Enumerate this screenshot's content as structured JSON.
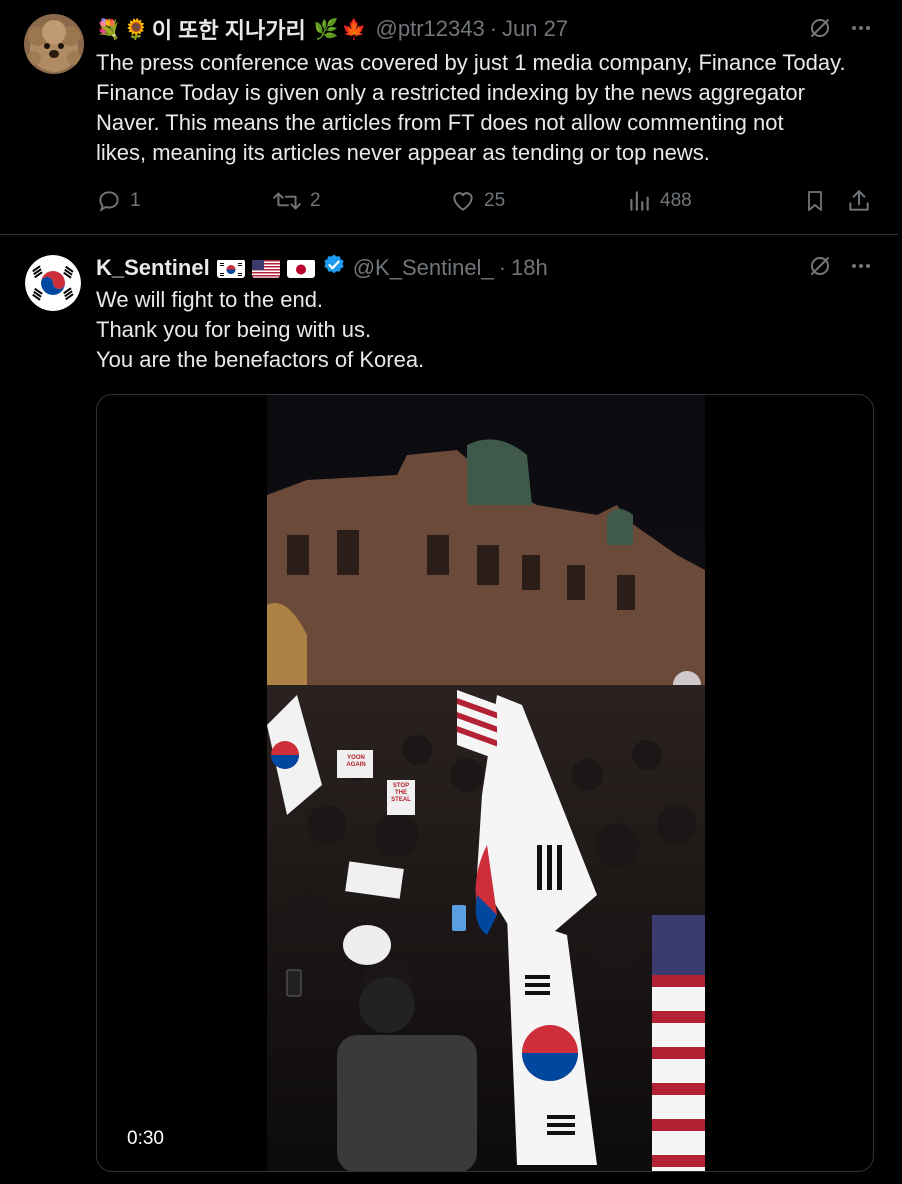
{
  "tweets": [
    {
      "display_name": "이 또한 지나가리",
      "name_emojis_before": [
        "💐",
        "🌻"
      ],
      "name_emojis_after": [
        "🌿",
        "🍁"
      ],
      "handle": "@ptr12343",
      "separator": "·",
      "time": "Jun 27",
      "text": "The press conference was covered by just 1 media company, Finance Today.\nFinance Today is given only a restricted indexing by the news aggregator\nNaver. This means the articles from FT does not allow commenting not\nlikes, meaning its articles never appear as tending or top news.",
      "stats": {
        "replies": "1",
        "retweets": "2",
        "likes": "25",
        "views": "488"
      },
      "icons": [
        "grok-icon",
        "more-icon",
        "reply-icon",
        "retweet-icon",
        "like-icon",
        "views-icon",
        "bookmark-icon",
        "share-icon"
      ]
    },
    {
      "display_name": "K_Sentinel",
      "flags": [
        "korea-flag",
        "us-flag",
        "japan-flag"
      ],
      "verified": true,
      "handle": "@K_Sentinel_",
      "separator": "·",
      "time": "18h",
      "text": "We will fight to the end.\nThank you for being with us.\nYou are the benefactors of Korea.",
      "video": {
        "duration": "0:30",
        "signs": [
          "YOON AGAIN",
          "STOP THE STEAL"
        ]
      }
    }
  ],
  "colors": {
    "background": "#000000",
    "text": "#e7e9ea",
    "muted": "#71767b",
    "border": "#2f3336",
    "verified": "#1d9bf0"
  }
}
